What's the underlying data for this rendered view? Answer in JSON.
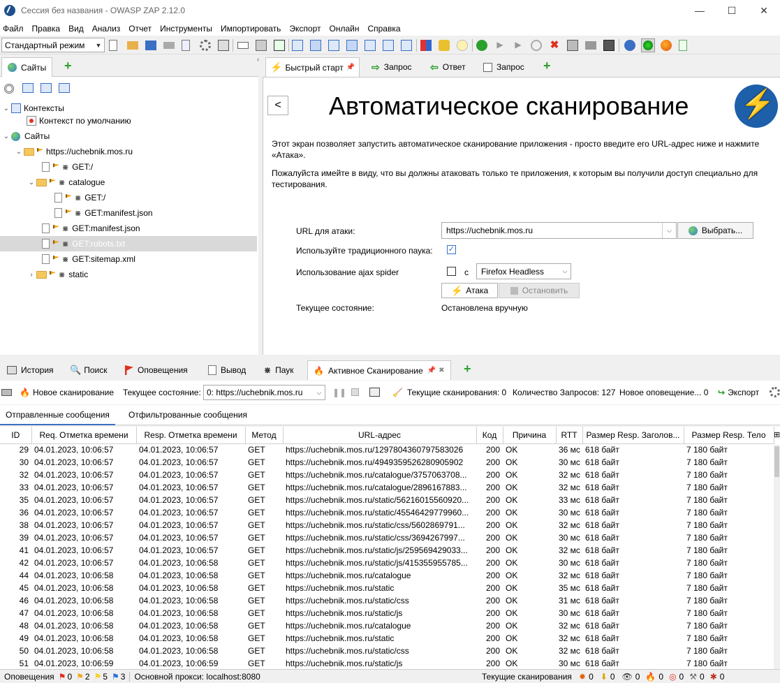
{
  "window": {
    "title": "Сессия без названия - OWASP ZAP 2.12.0",
    "minimize": "—",
    "maximize": "☐",
    "close": "✕"
  },
  "menu": [
    "Файл",
    "Правка",
    "Вид",
    "Анализ",
    "Отчет",
    "Инструменты",
    "Импортировать",
    "Экспорт",
    "Онлайн",
    "Справка"
  ],
  "toolbar": {
    "mode": "Стандартный режим"
  },
  "sites_panel": {
    "tab_label": "Сайты",
    "tree": {
      "contexts": "Контексты",
      "default_context": "Контекст по умолчанию",
      "sites": "Сайты",
      "host": "https://uchebnik.mos.ru",
      "get_root": "GET:/",
      "catalogue": "catalogue",
      "catalogue_get": "GET:/",
      "catalogue_manifest": "GET:manifest.json",
      "manifest": "GET:manifest.json",
      "robots": "GET:robots.txt",
      "sitemap": "GET:sitemap.xml",
      "static": "static"
    }
  },
  "work_tabs": [
    {
      "label": "Быстрый старт",
      "icon": "lightning-icon"
    },
    {
      "label": "Запрос",
      "icon": "arrow-right-icon"
    },
    {
      "label": "Ответ",
      "icon": "arrow-left-icon"
    },
    {
      "label": "Запрос",
      "icon": "request-editor-icon"
    }
  ],
  "quickstart": {
    "back": "<",
    "heading": "Автоматическое сканирование",
    "desc1": "Этот экран позволяет запустить автоматическое сканирование приложения - просто введите его URL-адрес ниже и нажмите «Атака».",
    "desc2": "Пожалуйста имейте в виду, что вы должны атаковать только те приложения, к которым вы получили доступ специально для тестирования.",
    "url_label": "URL для атаки:",
    "url_value": "https://uchebnik.mos.ru",
    "select_button": "Выбрать...",
    "traditional_label": "Используйте традиционного паука:",
    "traditional_checked": true,
    "ajax_label": "Использование ajax spider",
    "ajax_with": "с",
    "ajax_browser": "Firefox Headless",
    "attack_button": "Атака",
    "stop_button": "Остановить",
    "state_label": "Текущее состояние:",
    "state_value": "Остановлена вручную"
  },
  "bottom_tabs": [
    {
      "label": "История",
      "icon": "history-icon"
    },
    {
      "label": "Поиск",
      "icon": "search-icon"
    },
    {
      "label": "Оповещения",
      "icon": "alert-flag-icon"
    },
    {
      "label": "Вывод",
      "icon": "output-icon"
    },
    {
      "label": "Паук",
      "icon": "spider-icon"
    },
    {
      "label": "Активное Сканирование",
      "icon": "fire-icon"
    }
  ],
  "scan_toolbar": {
    "new_scan": "Новое сканирование",
    "state_label": "Текущее состояние:",
    "state_value": "0: https://uchebnik.mos.ru",
    "current_scans": "Текущие сканирования: 0",
    "requests": "Количество Запросов: 127",
    "new_alerts": "Новое оповещение... 0",
    "export": "Экспорт"
  },
  "sub_tabs": [
    "Отправленные сообщения",
    "Отфильтрованные сообщения"
  ],
  "table": {
    "columns": [
      "ID",
      "Req. Отметка времени",
      "Resp. Отметка времени",
      "Метод",
      "URL-адрес",
      "Код",
      "Причина",
      "RTT",
      "Размер Resp. Заголов...",
      "Размер Resp. Тело"
    ],
    "rows": [
      [
        "29",
        "04.01.2023, 10:06:57",
        "04.01.2023, 10:06:57",
        "GET",
        "https://uchebnik.mos.ru/1297804360797583026",
        "200",
        "OK",
        "36 мс",
        "618 байт",
        "7 180 байт"
      ],
      [
        "30",
        "04.01.2023, 10:06:57",
        "04.01.2023, 10:06:57",
        "GET",
        "https://uchebnik.mos.ru/4949359526280905902",
        "200",
        "OK",
        "30 мс",
        "618 байт",
        "7 180 байт"
      ],
      [
        "32",
        "04.01.2023, 10:06:57",
        "04.01.2023, 10:06:57",
        "GET",
        "https://uchebnik.mos.ru/catalogue/3757063708...",
        "200",
        "OK",
        "32 мс",
        "618 байт",
        "7 180 байт"
      ],
      [
        "33",
        "04.01.2023, 10:06:57",
        "04.01.2023, 10:06:57",
        "GET",
        "https://uchebnik.mos.ru/catalogue/2896167883...",
        "200",
        "OK",
        "32 мс",
        "618 байт",
        "7 180 байт"
      ],
      [
        "35",
        "04.01.2023, 10:06:57",
        "04.01.2023, 10:06:57",
        "GET",
        "https://uchebnik.mos.ru/static/56216015560920...",
        "200",
        "OK",
        "33 мс",
        "618 байт",
        "7 180 байт"
      ],
      [
        "36",
        "04.01.2023, 10:06:57",
        "04.01.2023, 10:06:57",
        "GET",
        "https://uchebnik.mos.ru/static/45546429779960...",
        "200",
        "OK",
        "30 мс",
        "618 байт",
        "7 180 байт"
      ],
      [
        "38",
        "04.01.2023, 10:06:57",
        "04.01.2023, 10:06:57",
        "GET",
        "https://uchebnik.mos.ru/static/css/5602869791...",
        "200",
        "OK",
        "32 мс",
        "618 байт",
        "7 180 байт"
      ],
      [
        "39",
        "04.01.2023, 10:06:57",
        "04.01.2023, 10:06:57",
        "GET",
        "https://uchebnik.mos.ru/static/css/3694267997...",
        "200",
        "OK",
        "30 мс",
        "618 байт",
        "7 180 байт"
      ],
      [
        "41",
        "04.01.2023, 10:06:57",
        "04.01.2023, 10:06:57",
        "GET",
        "https://uchebnik.mos.ru/static/js/259569429033...",
        "200",
        "OK",
        "32 мс",
        "618 байт",
        "7 180 байт"
      ],
      [
        "42",
        "04.01.2023, 10:06:57",
        "04.01.2023, 10:06:58",
        "GET",
        "https://uchebnik.mos.ru/static/js/415355955785...",
        "200",
        "OK",
        "30 мс",
        "618 байт",
        "7 180 байт"
      ],
      [
        "44",
        "04.01.2023, 10:06:58",
        "04.01.2023, 10:06:58",
        "GET",
        "https://uchebnik.mos.ru/catalogue",
        "200",
        "OK",
        "32 мс",
        "618 байт",
        "7 180 байт"
      ],
      [
        "45",
        "04.01.2023, 10:06:58",
        "04.01.2023, 10:06:58",
        "GET",
        "https://uchebnik.mos.ru/static",
        "200",
        "OK",
        "35 мс",
        "618 байт",
        "7 180 байт"
      ],
      [
        "46",
        "04.01.2023, 10:06:58",
        "04.01.2023, 10:06:58",
        "GET",
        "https://uchebnik.mos.ru/static/css",
        "200",
        "OK",
        "31 мс",
        "618 байт",
        "7 180 байт"
      ],
      [
        "47",
        "04.01.2023, 10:06:58",
        "04.01.2023, 10:06:58",
        "GET",
        "https://uchebnik.mos.ru/static/js",
        "200",
        "OK",
        "30 мс",
        "618 байт",
        "7 180 байт"
      ],
      [
        "48",
        "04.01.2023, 10:06:58",
        "04.01.2023, 10:06:58",
        "GET",
        "https://uchebnik.mos.ru/catalogue",
        "200",
        "OK",
        "32 мс",
        "618 байт",
        "7 180 байт"
      ],
      [
        "49",
        "04.01.2023, 10:06:58",
        "04.01.2023, 10:06:58",
        "GET",
        "https://uchebnik.mos.ru/static",
        "200",
        "OK",
        "32 мс",
        "618 байт",
        "7 180 байт"
      ],
      [
        "50",
        "04.01.2023, 10:06:58",
        "04.01.2023, 10:06:58",
        "GET",
        "https://uchebnik.mos.ru/static/css",
        "200",
        "OK",
        "32 мс",
        "618 байт",
        "7 180 байт"
      ],
      [
        "51",
        "04.01.2023, 10:06:59",
        "04.01.2023, 10:06:59",
        "GET",
        "https://uchebnik.mos.ru/static/js",
        "200",
        "OK",
        "30 мс",
        "618 байт",
        "7 180 байт"
      ]
    ]
  },
  "statusbar": {
    "alerts_label": "Оповещения",
    "alerts": [
      "0",
      "2",
      "5",
      "3"
    ],
    "proxy": "Основной прокси: localhost:8080",
    "current_scans_label": "Текущие сканирования",
    "counts": [
      "0",
      "0",
      "0",
      "0",
      "0",
      "0",
      "0"
    ]
  },
  "colors": {
    "selected_row": "#d9d9d9",
    "green": "#2ca02c",
    "flag_red": "#e03020",
    "flag_orange": "#f5a623",
    "flag_yellow": "#f5d023",
    "flag_blue": "#2b6fd6"
  }
}
